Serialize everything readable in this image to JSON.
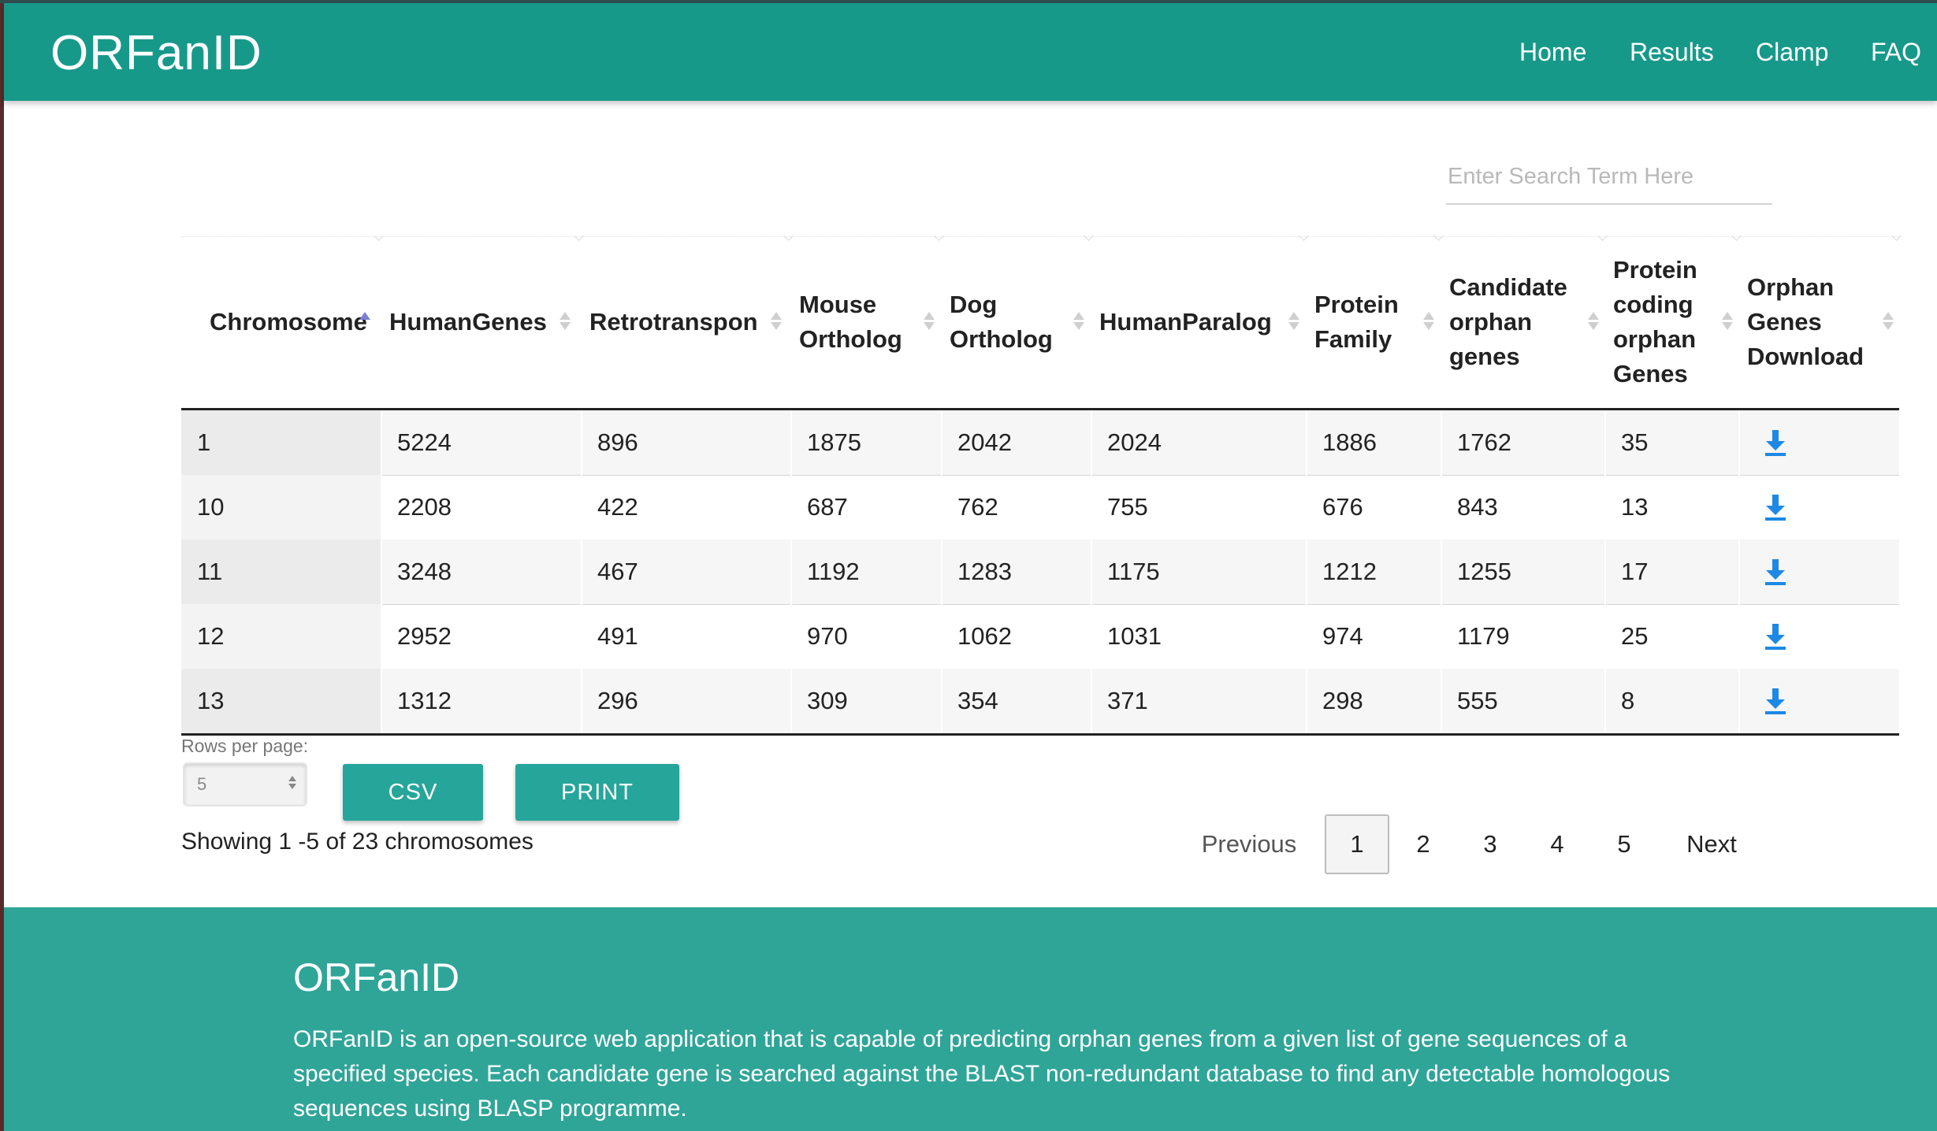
{
  "navbar": {
    "brand": "ORFanID",
    "links": [
      "Home",
      "Results",
      "Clamp",
      "FAQ"
    ]
  },
  "search": {
    "placeholder": "Enter Search Term Here"
  },
  "table": {
    "columns": [
      "Chromosome",
      "HumanGenes",
      "Retrotranspon",
      "Mouse Ortholog",
      "Dog Ortholog",
      "HumanParalog",
      "Protein Family",
      "Candidate orphan genes",
      "Protein coding orphan Genes",
      "Orphan Genes Download"
    ],
    "sorted_column": "Chromosome",
    "sort_direction": "ascending",
    "rows": [
      [
        "1",
        "5224",
        "896",
        "1875",
        "2042",
        "2024",
        "1886",
        "1762",
        "35"
      ],
      [
        "10",
        "2208",
        "422",
        "687",
        "762",
        "755",
        "676",
        "843",
        "13"
      ],
      [
        "11",
        "3248",
        "467",
        "1192",
        "1283",
        "1175",
        "1212",
        "1255",
        "17"
      ],
      [
        "12",
        "2952",
        "491",
        "970",
        "1062",
        "1031",
        "974",
        "1179",
        "25"
      ],
      [
        "13",
        "1312",
        "296",
        "309",
        "354",
        "371",
        "298",
        "555",
        "8"
      ]
    ],
    "download_icon": "download-icon"
  },
  "controls": {
    "rows_per_page_label": "Rows per page:",
    "rows_per_page_value": "5",
    "csv_label": "CSV",
    "print_label": "PRINT",
    "showing_text": "Showing 1 -5 of 23 chromosomes"
  },
  "pagination": {
    "previous": "Previous",
    "pages": [
      "1",
      "2",
      "3",
      "4",
      "5"
    ],
    "current": "1",
    "next": "Next"
  },
  "footer": {
    "title": "ORFanID",
    "text": "ORFanID is an open-source web application that is capable of predicting orphan genes from a given list of gene sequences of a specified species. Each candidate gene is searched against the BLAST non-redundant database to find any detectable homologous sequences using BLASP programme."
  },
  "colors": {
    "navbar": "#17998a",
    "footer": "#2fa598",
    "button": "#26a69a",
    "download_icon": "#1e88e5"
  }
}
